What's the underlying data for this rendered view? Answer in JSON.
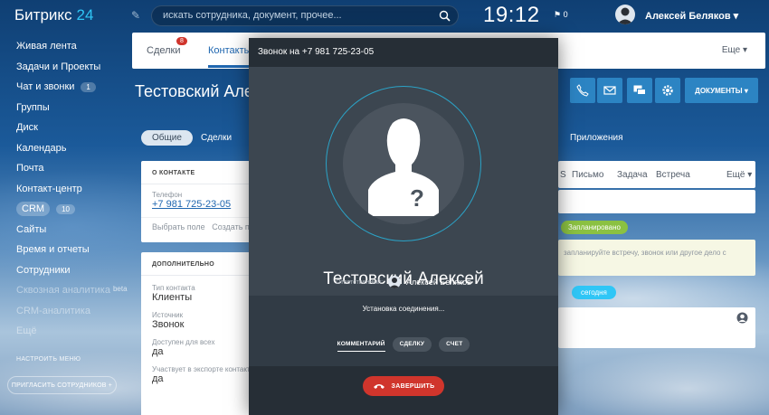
{
  "header": {
    "logo_text": "Битрикс",
    "logo_number": "24",
    "search_placeholder": "искать сотрудника, документ, прочее...",
    "clock": "19:12",
    "flag_count": "0",
    "user_name": "Алексей Беляков"
  },
  "sidebar": {
    "items": [
      {
        "label": "Живая лента"
      },
      {
        "label": "Задачи и Проекты"
      },
      {
        "label": "Чат и звонки",
        "count": "1"
      },
      {
        "label": "Группы"
      },
      {
        "label": "Диск"
      },
      {
        "label": "Календарь"
      },
      {
        "label": "Почта"
      },
      {
        "label": "Контакт-центр"
      },
      {
        "label": "CRM",
        "count": "10"
      },
      {
        "label": "Сайты"
      },
      {
        "label": "Время и отчеты"
      },
      {
        "label": "Сотрудники"
      },
      {
        "label": "Сквозная аналитика",
        "sup": "beta"
      },
      {
        "label": "CRM-аналитика"
      },
      {
        "label": "Ещё"
      }
    ],
    "settings_label": "НАСТРОИТЬ МЕНЮ",
    "invite_label": "ПРИГЛАСИТЬ СОТРУДНИКОВ"
  },
  "crm": {
    "tabs": [
      {
        "label": "Сделки",
        "badge": "8"
      },
      {
        "label": "Контакты"
      }
    ],
    "more_label": "Еще",
    "title": "Тестовский Алекс",
    "documents_label": "ДОКУМЕНТЫ",
    "subtabs": [
      "Общие",
      "Сделки",
      "Приложения"
    ],
    "about": {
      "header": "О КОНТАКТЕ",
      "phone_label": "Телефон",
      "phone_value": "+7 981 725-23-05",
      "select_field": "Выбрать поле",
      "create_field": "Создать пол"
    },
    "extra": {
      "header": "ДОПОЛНИТЕЛЬНО",
      "fields": [
        {
          "label": "Тип контакта",
          "value": "Клиенты"
        },
        {
          "label": "Источник",
          "value": "Звонок"
        },
        {
          "label": "Доступен для всех",
          "value": "да"
        },
        {
          "label": "Участвует в экспорте контакто",
          "value": "да"
        }
      ]
    },
    "activity_tabs": [
      "S",
      "Письмо",
      "Задача",
      "Встреча",
      "Ещё"
    ],
    "planned_label": "Запланировано",
    "note_text": "запланируйте встречу, звонок или другое дело с",
    "today_label": "сегодня"
  },
  "call": {
    "title": "Звонок на +7 981 725-23-05",
    "contact_name": "Тестовский Алексей",
    "responsible_label": "Ответственный:",
    "responsible_name": "Алексей Беляков",
    "status": "Установка соединения...",
    "tabs": [
      "КОММЕНТАРИЙ",
      "СДЕЛКУ",
      "СЧЕТ"
    ],
    "end_label": "ЗАВЕРШИТЬ"
  },
  "colors": {
    "accent": "#2067b0",
    "call_end": "#d0352c",
    "ring": "#2ba3c7",
    "planned": "#8bc142",
    "today": "#2fc6f6"
  }
}
